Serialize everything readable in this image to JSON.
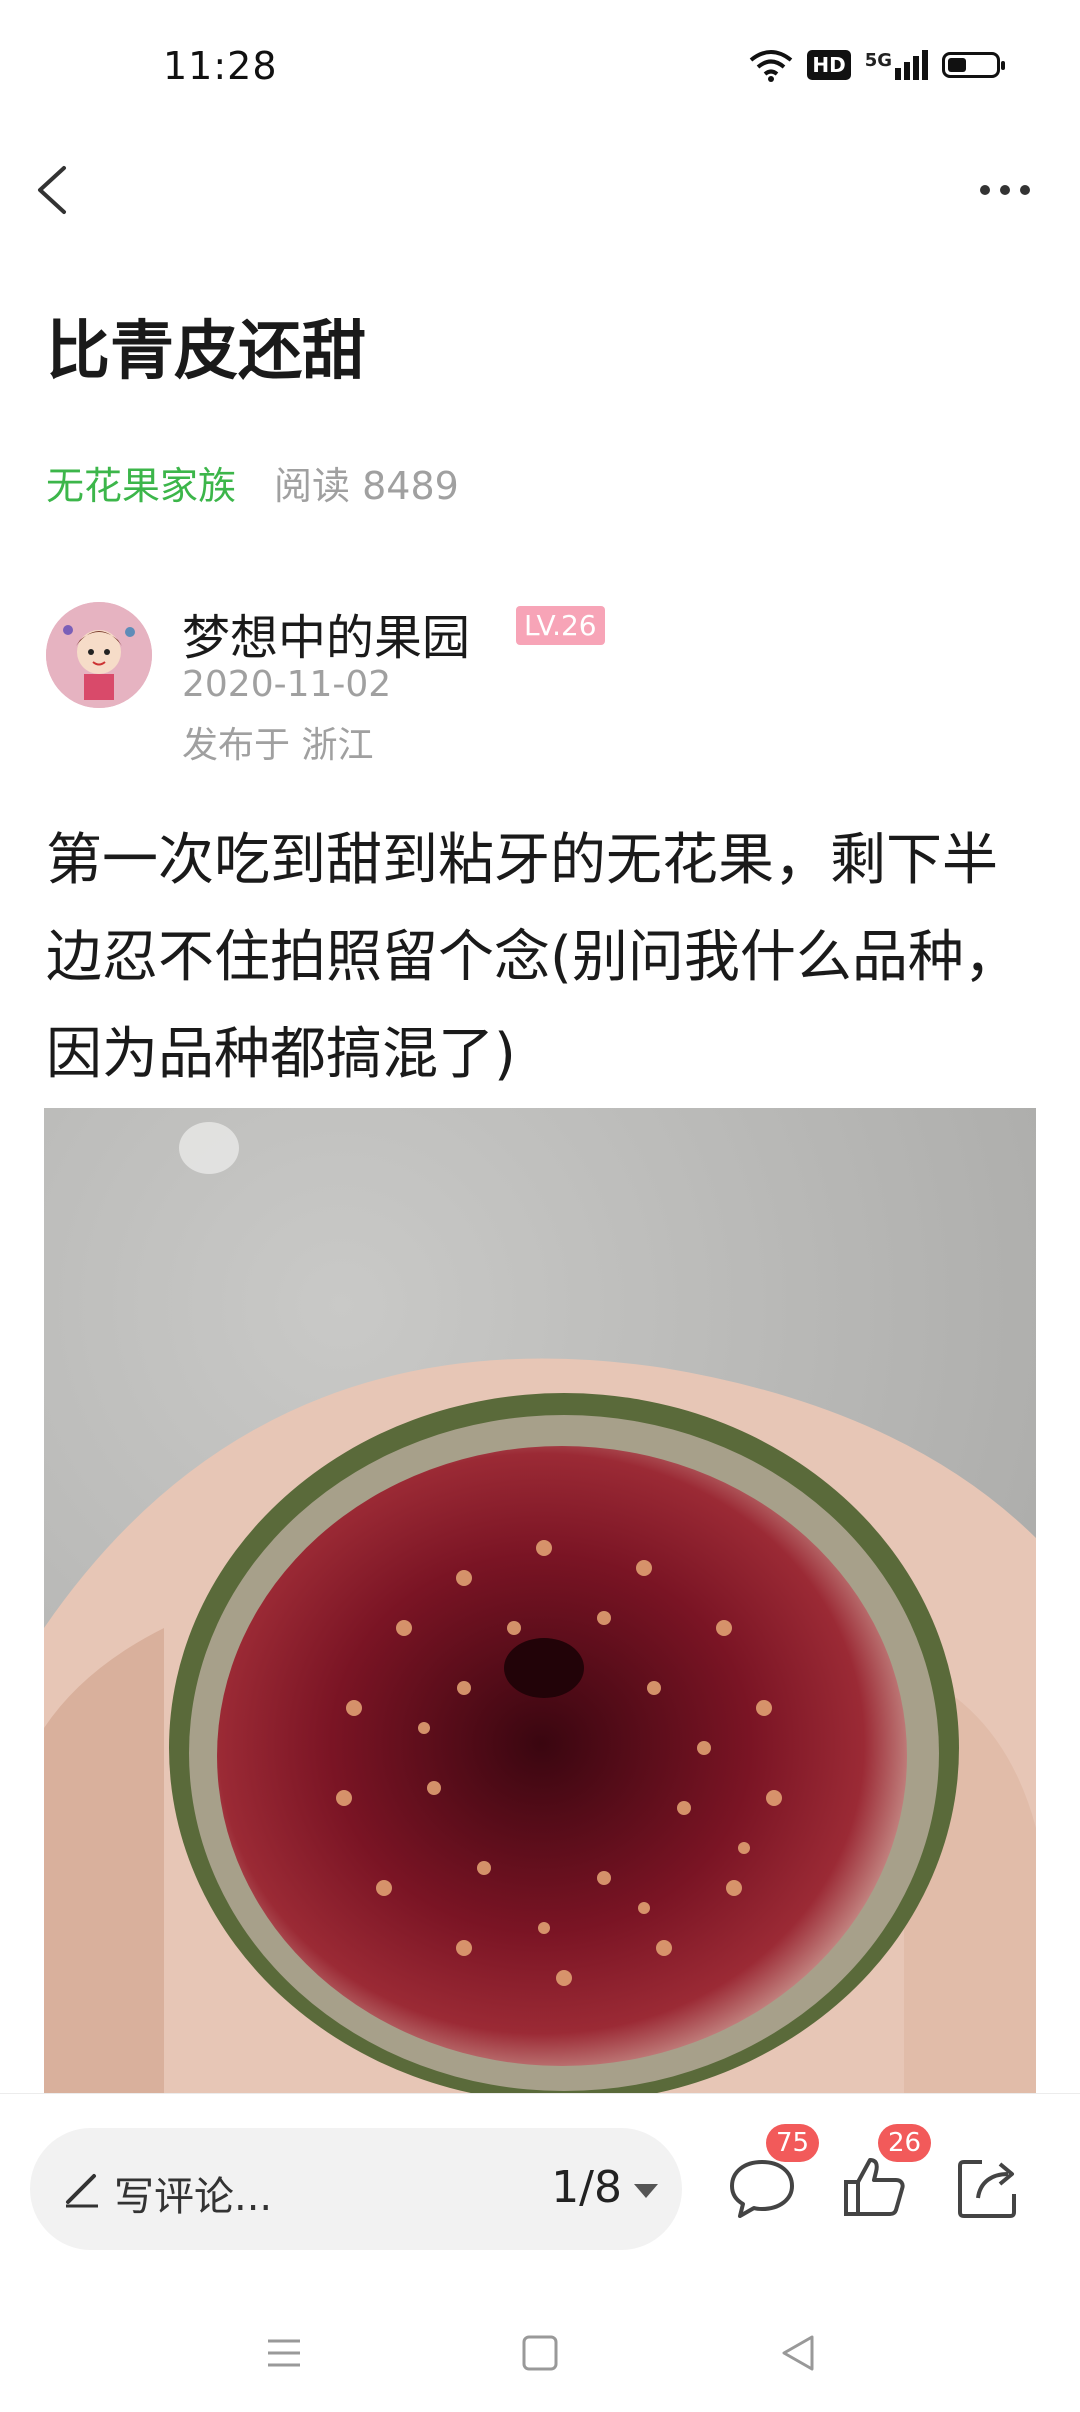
{
  "status_bar": {
    "time": "11:28",
    "network_badge": "HD",
    "network_type": "5G",
    "battery_level": 0.35,
    "icons": [
      "wifi-icon",
      "hd-icon",
      "signal-5g-icon",
      "battery-icon"
    ]
  },
  "nav": {
    "back_icon": "back-arrow-icon",
    "more_icon": "more-dots-icon"
  },
  "post": {
    "title": "比青皮还甜",
    "group": "无花果家族",
    "read_label": "阅读 8489",
    "author": {
      "name": "梦想中的果园",
      "level": "LV.26",
      "date": "2020-11-02",
      "location": "发布于 浙江"
    },
    "body": "第一次吃到甜到粘牙的无花果，剩下半边忍不住拍照留个念(别问我什么品种，因为品种都搞混了)"
  },
  "bottom_bar": {
    "comment_placeholder": "写评论...",
    "page_indicator": "1/8",
    "comment_count": "75",
    "like_count": "26",
    "accent_color": "#f25a5a"
  },
  "colors": {
    "group_link": "#3cb64a",
    "level_badge": "#f7a4b7",
    "meta_text": "#a0a0a0"
  }
}
